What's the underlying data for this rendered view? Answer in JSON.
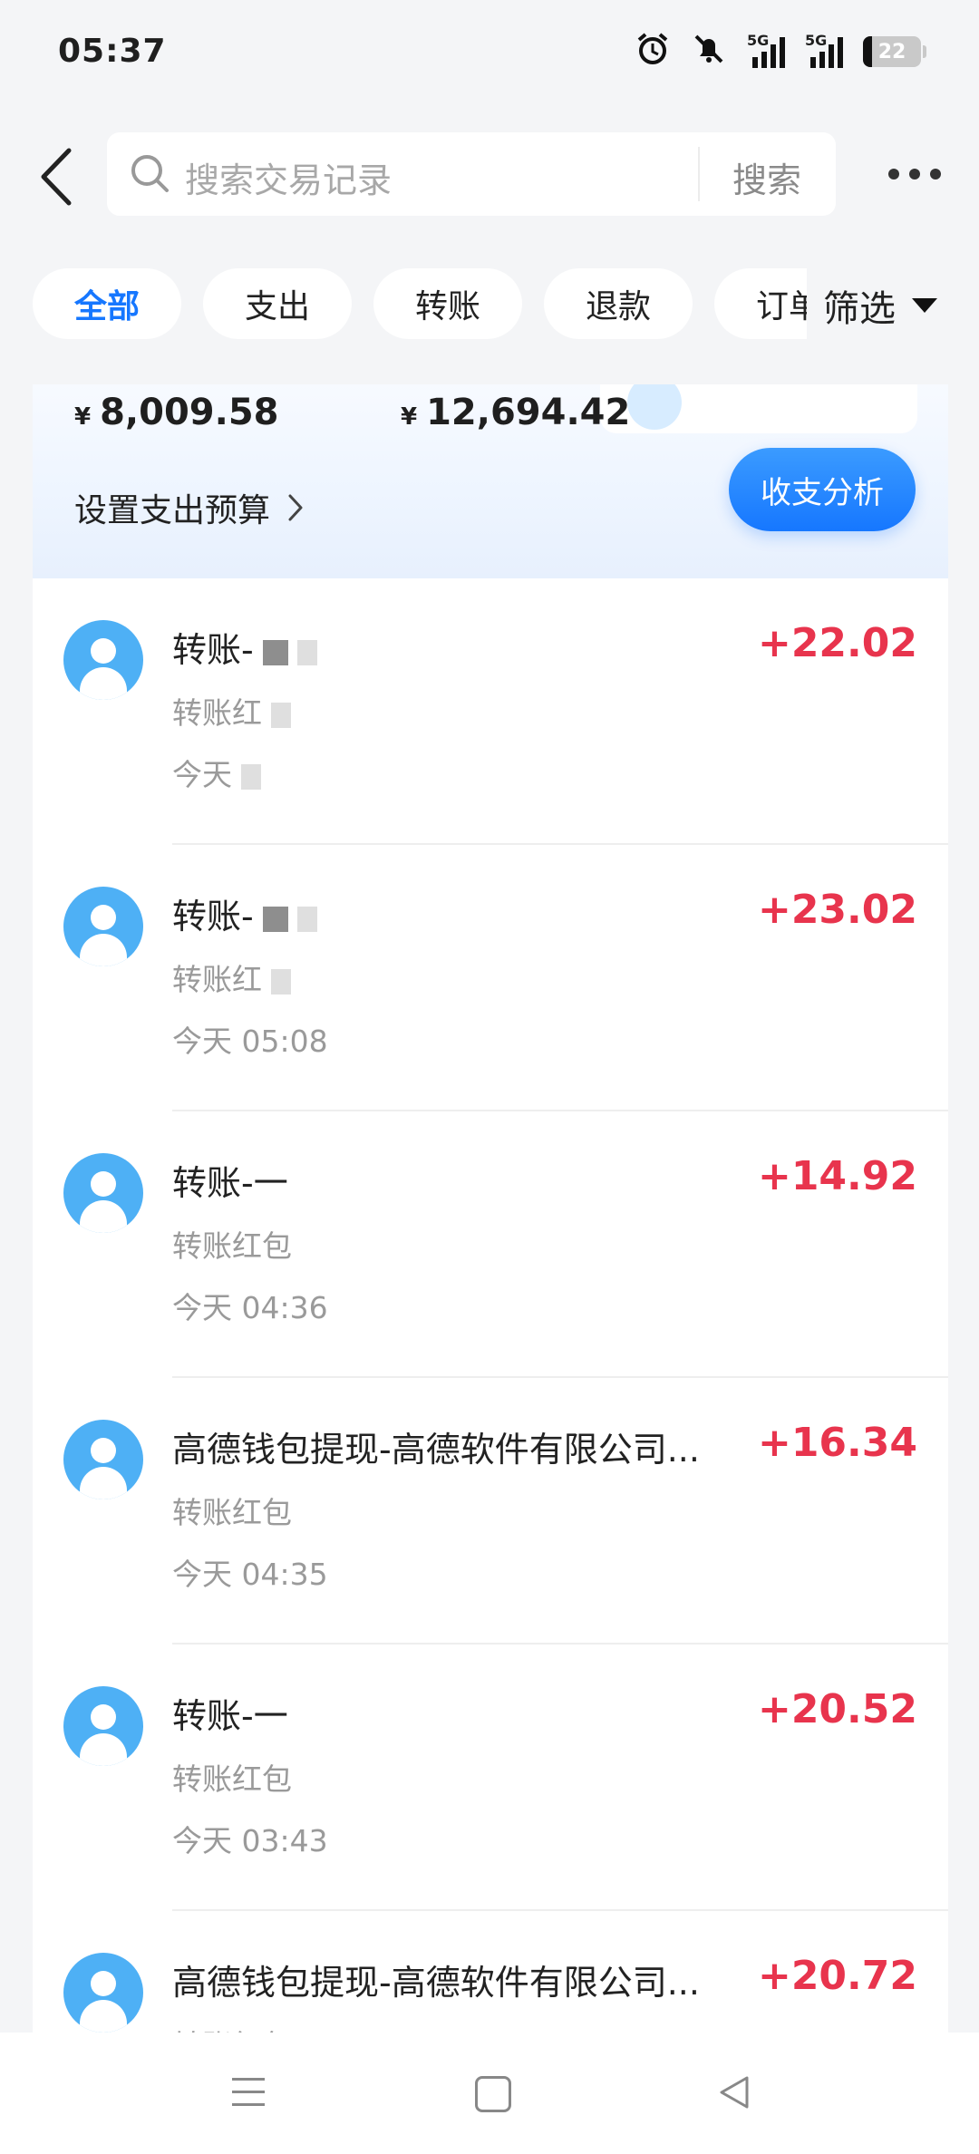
{
  "status_bar": {
    "time": "05:37",
    "network1": "5G",
    "network2": "5G",
    "battery": "22"
  },
  "search": {
    "placeholder": "搜索交易记录",
    "button": "搜索"
  },
  "chips": [
    {
      "label": "全部",
      "active": true
    },
    {
      "label": "支出"
    },
    {
      "label": "转账"
    },
    {
      "label": "退款"
    },
    {
      "label": "订单"
    }
  ],
  "filter_label": "筛选",
  "summary": {
    "currency": "¥",
    "amount_left": "8,009.58",
    "amount_right": "12,694.42",
    "budget_label": "设置支出预算",
    "analyze_button": "收支分析"
  },
  "transactions": [
    {
      "title": "转账-",
      "subtitle": "转账红",
      "time": "今天",
      "amount": "+22.02"
    },
    {
      "title": "转账-",
      "subtitle": "转账红",
      "time": "今天 05:08",
      "amount": "+23.02"
    },
    {
      "title": "转账-一",
      "subtitle": "转账红包",
      "time": "今天 04:36",
      "amount": "+14.92"
    },
    {
      "title": "高德钱包提现-高德软件有限公司...",
      "subtitle": "转账红包",
      "time": "今天 04:35",
      "amount": "+16.34"
    },
    {
      "title": "转账-一",
      "subtitle": "转账红包",
      "time": "今天 03:43",
      "amount": "+20.52"
    },
    {
      "title": "高德钱包提现-高德软件有限公司...",
      "subtitle": "转账红包",
      "time": "",
      "amount": "+20.72"
    }
  ],
  "colors": {
    "accent": "#1677ff",
    "income": "#e8344d",
    "avatar": "#4eb0f5"
  }
}
